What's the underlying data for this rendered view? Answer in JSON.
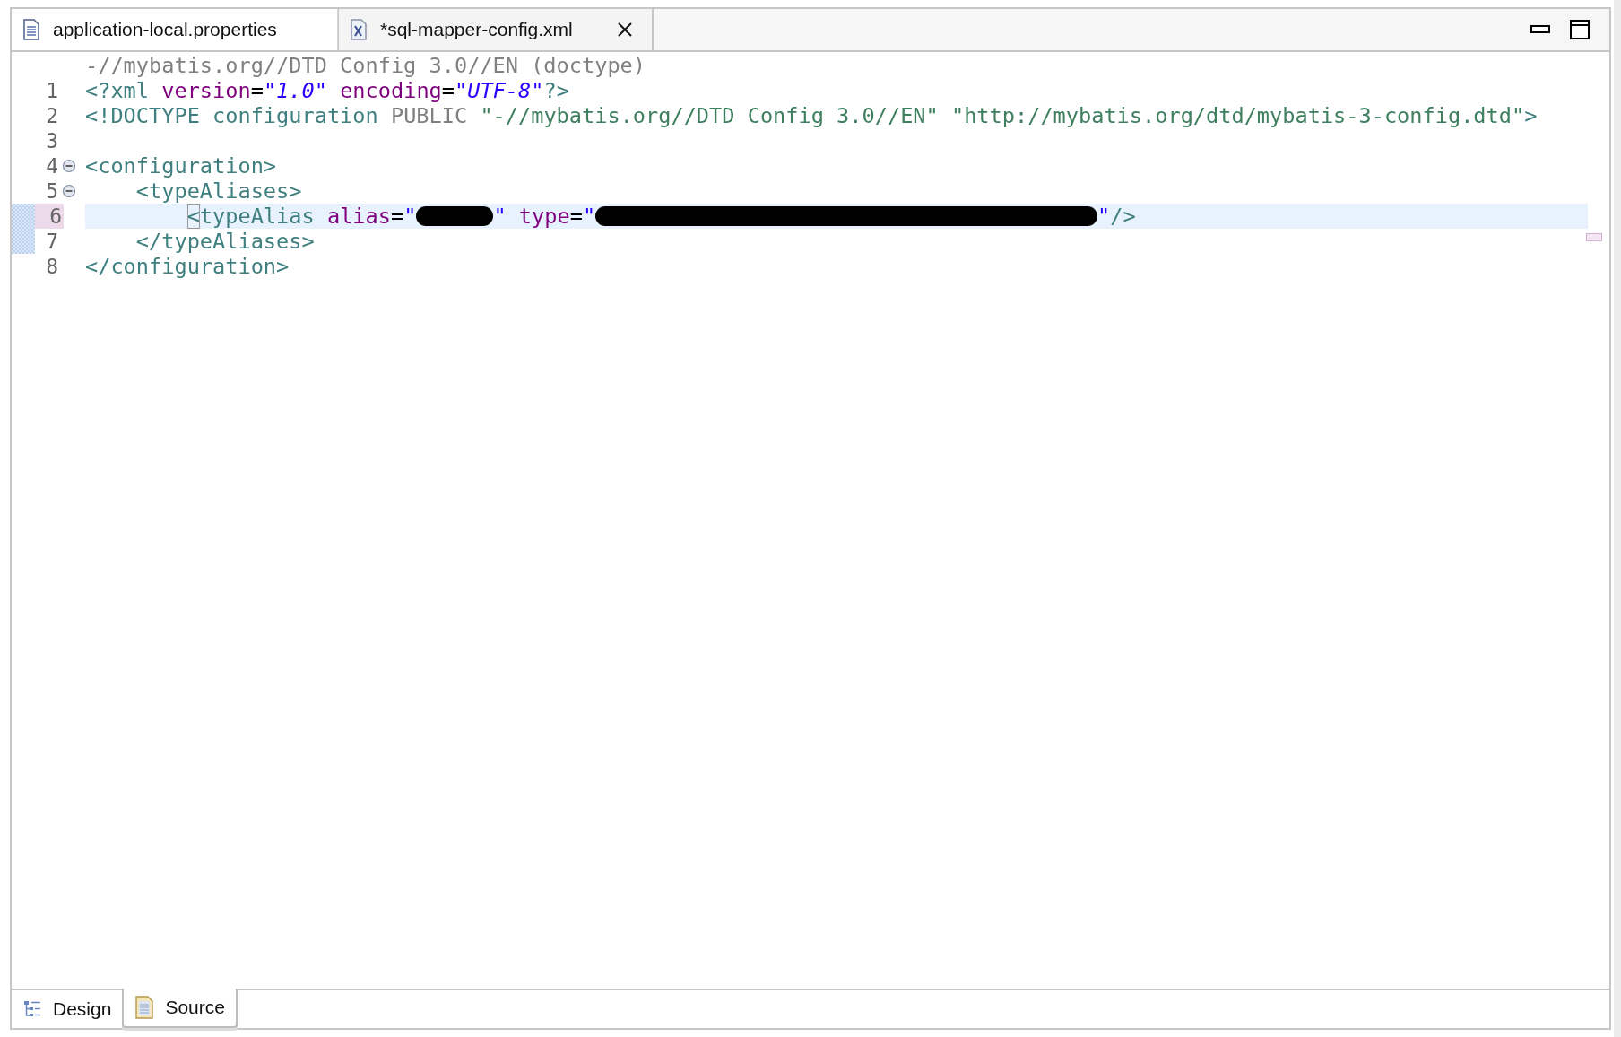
{
  "editor_tabs": [
    {
      "label": "application-local.properties",
      "selected": false
    },
    {
      "label": "*sql-mapper-config.xml",
      "selected": true
    }
  ],
  "doctype_hint": "-//mybatis.org//DTD Config 3.0//EN (doctype)",
  "lines": [
    {
      "number": "1",
      "current": false,
      "changed": false,
      "tokens": [
        {
          "kind": "tag",
          "text": "<?xml"
        },
        {
          "kind": "attr",
          "text": " version"
        },
        {
          "kind": "eq",
          "text": "="
        },
        {
          "kind": "string",
          "text": "\"1.0\""
        },
        {
          "kind": "attr",
          "text": " encoding"
        },
        {
          "kind": "eq",
          "text": "="
        },
        {
          "kind": "string",
          "text": "\"UTF-8\""
        },
        {
          "kind": "tag",
          "text": "?>"
        }
      ]
    },
    {
      "number": "2",
      "current": false,
      "changed": false,
      "tokens": [
        {
          "kind": "tag",
          "text": "<!DOCTYPE configuration"
        },
        {
          "kind": "keyword",
          "text": " PUBLIC "
        },
        {
          "kind": "doctype_string",
          "text": "\"-//mybatis.org//DTD Config 3.0//EN\" \"http://mybatis.org/dtd/mybatis-3-config.dtd\""
        },
        {
          "kind": "tag",
          "text": ">"
        }
      ]
    },
    {
      "number": "3",
      "current": false,
      "changed": false
    },
    {
      "number": "4",
      "current": false,
      "changed": false,
      "expanded": true,
      "tokens": [
        {
          "kind": "tag",
          "text": "<configuration>"
        }
      ]
    },
    {
      "number": "5",
      "current": false,
      "changed": false,
      "expanded": true,
      "tokens": [
        {
          "kind": "tag",
          "text": "    <typeAliases>"
        }
      ]
    },
    {
      "number": "6",
      "current": true,
      "changed": true,
      "tokens": [
        {
          "kind": "matched_bracket",
          "text": "        <"
        },
        {
          "kind": "tag",
          "text": "typeAlias"
        },
        {
          "kind": "attr",
          "text": " alias"
        },
        {
          "kind": "eq",
          "text": "="
        },
        {
          "kind": "string",
          "text": "\""
        },
        {
          "kind": "redacted"
        },
        {
          "kind": "string",
          "text": "\""
        },
        {
          "kind": "attr",
          "text": " type"
        },
        {
          "kind": "eq",
          "text": "="
        },
        {
          "kind": "string",
          "text": "\""
        },
        {
          "kind": "redacted"
        },
        {
          "kind": "string",
          "text": "\""
        },
        {
          "kind": "tag",
          "text": "/>"
        }
      ]
    },
    {
      "number": "7",
      "current": false,
      "changed": true,
      "tokens": [
        {
          "kind": "tag",
          "text": "    </typeAliases>"
        }
      ]
    },
    {
      "number": "8",
      "current": false,
      "changed": false,
      "tokens": [
        {
          "kind": "tag",
          "text": "</configuration>"
        }
      ]
    }
  ],
  "bottom_tabs": [
    {
      "label": "Design",
      "selected": false
    },
    {
      "label": "Source",
      "selected": true
    }
  ]
}
